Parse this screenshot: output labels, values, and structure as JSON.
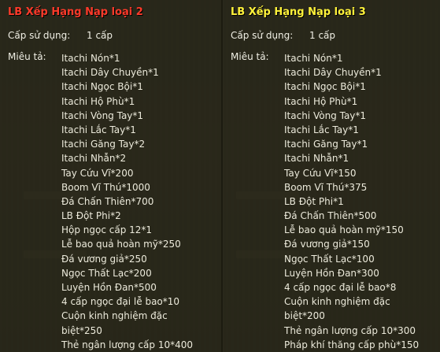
{
  "panels": [
    {
      "title": "LB Xếp Hạng Nạp loại 2",
      "usage_label": "Cấp sử dụng:",
      "usage_value": "1 cấp",
      "desc_label": "Miêu tả:",
      "items": [
        "Itachi Nón*1",
        "Itachi Dây Chuyền*1",
        "Itachi Ngọc Bội*1",
        "Itachi Hộ Phù*1",
        "Itachi Vòng Tay*1",
        "Itachi Lắc Tay*1",
        "Itachi Găng Tay*2",
        "Itachi Nhẫn*2",
        "Tay Cứu Vĩ*200",
        "Boom Vĩ Thú*1000",
        "Đá Chấn Thiên*700",
        "LB Đột Phi*2",
        "Hộp ngọc cấp 12*1",
        "Lễ bao quả hoàn mỹ*250",
        "Đá vương giả*250",
        "Ngọc Thất Lạc*200",
        "Luyện Hồn Đan*500",
        "4 cấp ngọc đại lễ bao*10",
        "Cuộn kinh nghiệm đặc",
        "biệt*250",
        "Thẻ ngân lượng cấp 10*400"
      ]
    },
    {
      "title": "LB Xếp Hạng Nạp loại 3",
      "usage_label": "Cấp sử dụng:",
      "usage_value": "1 cấp",
      "desc_label": "Miêu tả:",
      "items": [
        "Itachi Nón*1",
        "Itachi Dây Chuyền*1",
        "Itachi Ngọc Bội*1",
        "Itachi Hộ Phù*1",
        "Itachi Vòng Tay*1",
        "Itachi Lắc Tay*1",
        "Itachi Găng Tay*1",
        "Itachi Nhẫn*1",
        "Tay Cứu Vĩ*150",
        "Boom Vĩ Thú*375",
        "LB Đột Phi*1",
        "Đá Chấn Thiên*500",
        "Lễ bao quả hoàn mỹ*150",
        "Đá vương giả*150",
        "Ngọc Thất Lạc*100",
        "Luyện Hồn Đan*300",
        "4 cấp ngọc đại lễ bao*8",
        "Cuộn kinh nghiệm đặc",
        "biệt*200",
        "Thẻ ngân lượng cấp 10*300",
        "Pháp khí thăng cấp phù*150"
      ]
    }
  ]
}
